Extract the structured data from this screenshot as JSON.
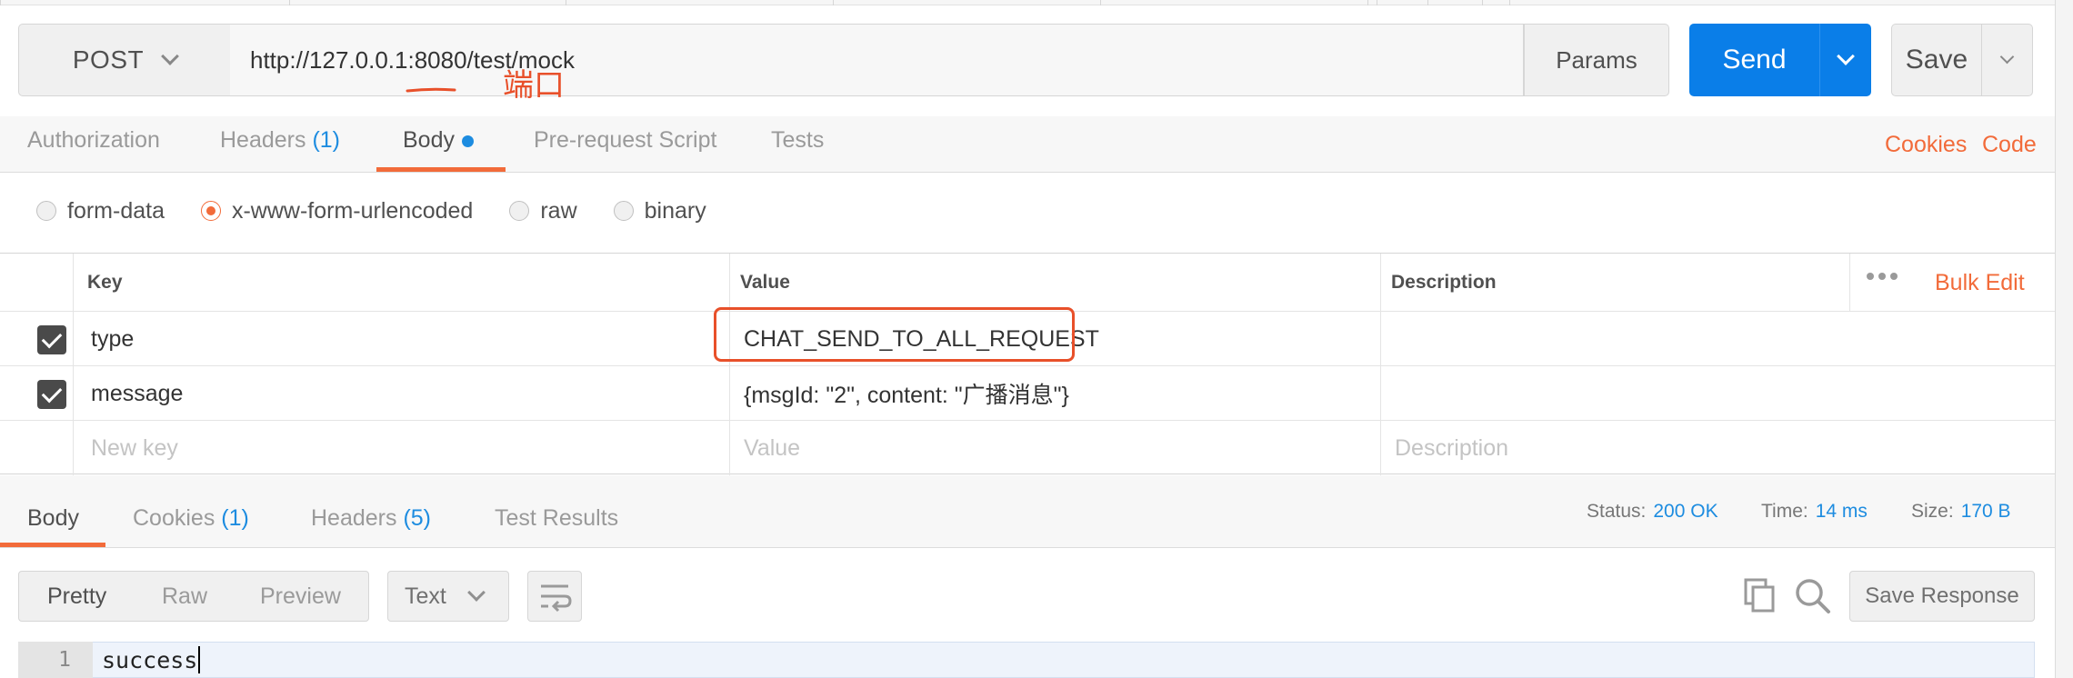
{
  "request": {
    "method": "POST",
    "url": "http://127.0.0.1:8080/test/mock",
    "params_label": "Params",
    "send_label": "Send",
    "save_label": "Save"
  },
  "annotation": {
    "text": "端口",
    "color": "#e8502a"
  },
  "request_tabs": [
    {
      "label": "Authorization",
      "count": ""
    },
    {
      "label": "Headers",
      "count": "(1)"
    },
    {
      "label": "Body",
      "count": "",
      "active": true
    },
    {
      "label": "Pre-request Script",
      "count": ""
    },
    {
      "label": "Tests",
      "count": ""
    }
  ],
  "links": {
    "cookies": "Cookies",
    "code": "Code"
  },
  "body_modes": {
    "options": [
      "form-data",
      "x-www-form-urlencoded",
      "raw",
      "binary"
    ],
    "selected": "x-www-form-urlencoded"
  },
  "kv_table": {
    "headers": {
      "key": "Key",
      "value": "Value",
      "description": "Description"
    },
    "bulk_edit": "Bulk Edit",
    "rows": [
      {
        "checked": true,
        "key": "type",
        "value": "CHAT_SEND_TO_ALL_REQUEST",
        "description": ""
      },
      {
        "checked": true,
        "key": "message",
        "value": "{msgId: \"2\", content: \"广播消息\"}",
        "description": ""
      }
    ],
    "placeholders": {
      "key": "New key",
      "value": "Value",
      "description": "Description"
    }
  },
  "response": {
    "tabs": [
      {
        "label": "Body",
        "count": "",
        "active": true
      },
      {
        "label": "Cookies",
        "count": "(1)"
      },
      {
        "label": "Headers",
        "count": "(5)"
      },
      {
        "label": "Test Results",
        "count": ""
      }
    ],
    "status_label": "Status:",
    "status": "200 OK",
    "time_label": "Time:",
    "time": "14 ms",
    "size_label": "Size:",
    "size": "170 B",
    "view_modes": [
      "Pretty",
      "Raw",
      "Preview"
    ],
    "active_view": "Pretty",
    "format": "Text",
    "save_response": "Save Response",
    "lines": [
      {
        "number": "1",
        "text": "success"
      }
    ]
  },
  "colors": {
    "accent": "#f26b3a",
    "primary": "#0a7ee8",
    "link": "#1d8ce0"
  }
}
